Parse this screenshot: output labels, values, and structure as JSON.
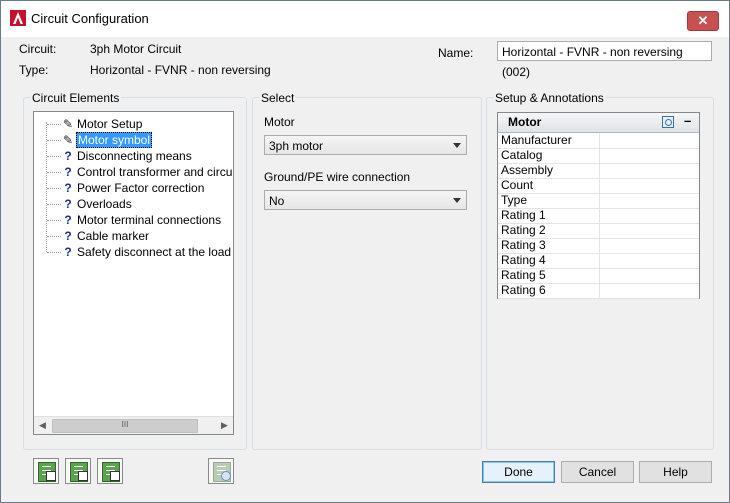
{
  "window": {
    "title": "Circuit Configuration",
    "close_symbol": "✕"
  },
  "info": {
    "circuit_label": "Circuit:",
    "circuit_value": "3ph Motor Circuit",
    "type_label": "Type:",
    "type_value": "Horizontal - FVNR - non reversing",
    "name_label": "Name:",
    "name_value": "Horizontal - FVNR - non reversing (002)"
  },
  "circuit_elements": {
    "title": "Circuit Elements",
    "items": [
      {
        "icon": "pencil-icon",
        "label": "Motor Setup"
      },
      {
        "icon": "pencil-icon",
        "label": "Motor symbol",
        "selected": true
      },
      {
        "icon": "question-icon",
        "label": "Disconnecting means"
      },
      {
        "icon": "question-icon",
        "label": "Control transformer and circuit - no"
      },
      {
        "icon": "question-icon",
        "label": "Power Factor correction"
      },
      {
        "icon": "question-icon",
        "label": "Overloads"
      },
      {
        "icon": "question-icon",
        "label": "Motor terminal connections"
      },
      {
        "icon": "question-icon",
        "label": "Cable marker"
      },
      {
        "icon": "question-icon",
        "label": "Safety disconnect at the load"
      }
    ],
    "scroll_thumb": "III"
  },
  "select": {
    "title": "Select",
    "motor_label": "Motor",
    "motor_value": "3ph motor",
    "ground_label": "Ground/PE wire connection",
    "ground_value": "No"
  },
  "setup": {
    "title": "Setup & Annotations",
    "header": "Motor",
    "collapse_symbol": "–",
    "rows": [
      "Manufacturer",
      "Catalog",
      "Assembly",
      "Count",
      "Type",
      "Rating 1",
      "Rating 2",
      "Rating 3",
      "Rating 4",
      "Rating 5",
      "Rating 6"
    ]
  },
  "buttons": {
    "done": "Done",
    "cancel": "Cancel",
    "help": "Help"
  }
}
